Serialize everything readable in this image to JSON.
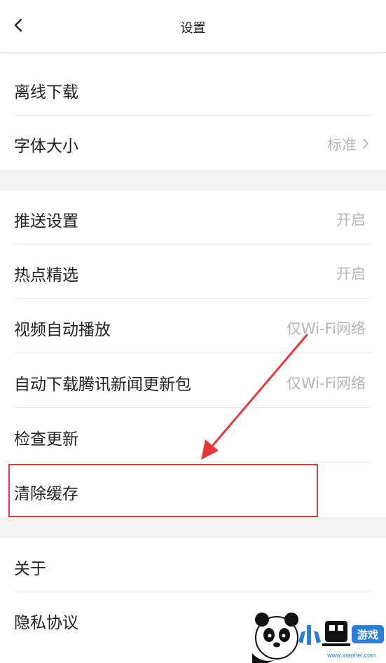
{
  "header": {
    "title": "设置",
    "back_icon": "chevron-left-icon"
  },
  "sections": [
    {
      "rows": [
        {
          "label": "离线下载"
        },
        {
          "label": "字体大小",
          "value": "标准",
          "chevron": true
        }
      ]
    },
    {
      "rows": [
        {
          "label": "推送设置",
          "value": "开启"
        },
        {
          "label": "热点精选",
          "value": "开启"
        },
        {
          "label": "视频自动播放",
          "value": "仅Wi-Fi网络"
        },
        {
          "label": "自动下载腾讯新闻更新包",
          "value": "仅Wi-Fi网络"
        },
        {
          "label": "检查更新"
        },
        {
          "label": "清除缓存",
          "highlighted": true
        }
      ]
    },
    {
      "rows": [
        {
          "label": "关于"
        },
        {
          "label": "隐私协议"
        }
      ]
    }
  ],
  "annotation": {
    "color": "#e23a3a",
    "highlight_target": "清除缓存"
  },
  "watermark": {
    "brand": "小黑游戏",
    "url": "www.xiaohei.com"
  }
}
